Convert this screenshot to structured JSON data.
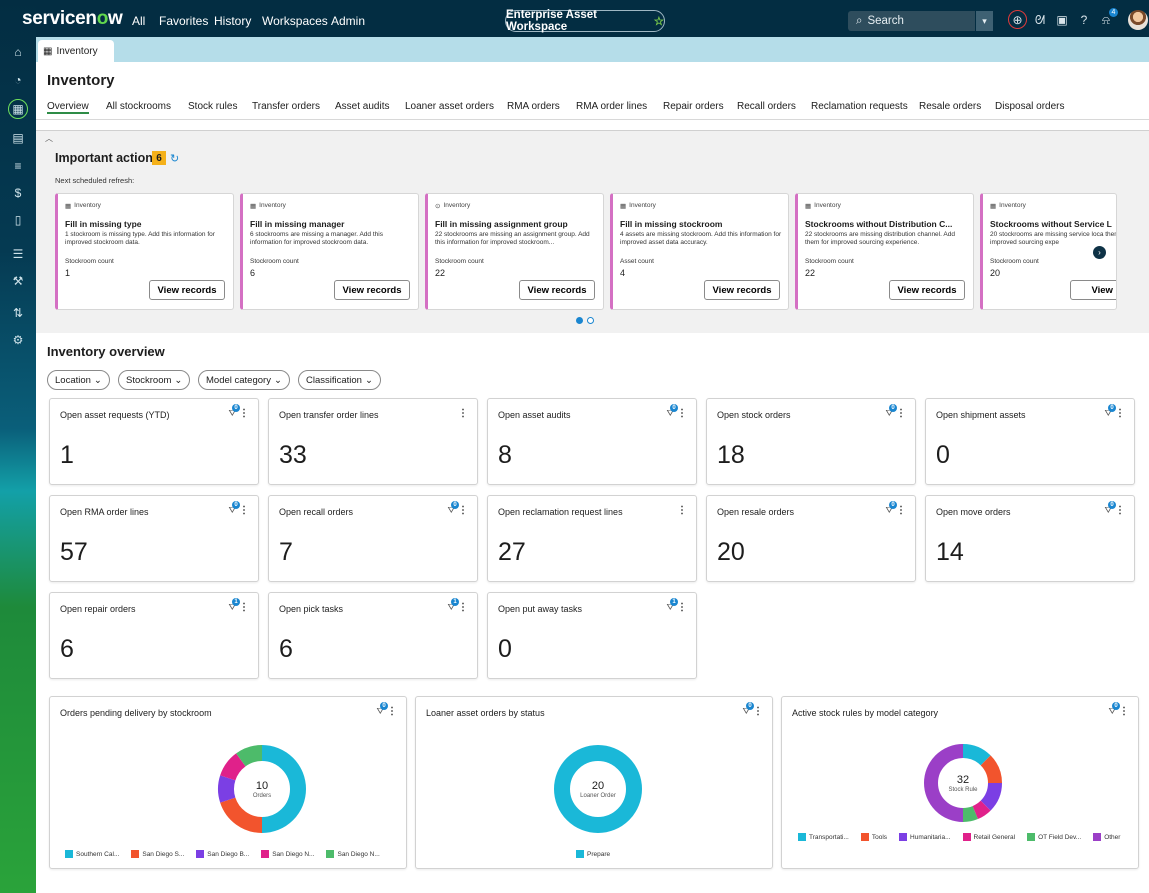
{
  "topbar": {
    "brand_prefix": "servicen",
    "brand_o": "o",
    "brand_suffix": "w",
    "nav": [
      "All",
      "Favorites",
      "History",
      "Workspaces",
      "Admin"
    ],
    "workspace": "Enterprise Asset Workspace",
    "search_placeholder": "Search",
    "notification_count": "4"
  },
  "tab": {
    "label": "Inventory"
  },
  "page": {
    "title": "Inventory"
  },
  "subtabs": [
    "Overview",
    "All stockrooms",
    "Stock rules",
    "Transfer orders",
    "Asset audits",
    "Loaner asset orders",
    "RMA orders",
    "RMA order lines",
    "Repair orders",
    "Recall orders",
    "Reclamation requests",
    "Resale orders",
    "Disposal orders"
  ],
  "important_actions": {
    "title": "Important actions",
    "count": "6",
    "next_refresh": "Next scheduled refresh:",
    "cards": [
      {
        "kicker": "Inventory",
        "title": "Fill in missing type",
        "desc": "1 stockroom is missing type. Add this information for improved stockroom data.",
        "label": "Stockroom count",
        "value": "1",
        "button": "View records"
      },
      {
        "kicker": "Inventory",
        "title": "Fill in missing manager",
        "desc": "6 stockrooms are missing a manager. Add this information for improved stockroom data.",
        "label": "Stockroom count",
        "value": "6",
        "button": "View records"
      },
      {
        "kicker": "Inventory",
        "title": "Fill in missing assignment group",
        "desc": "22 stockrooms are missing an assignment group. Add this information for improved stockroom...",
        "label": "Stockroom count",
        "value": "22",
        "button": "View records"
      },
      {
        "kicker": "Inventory",
        "title": "Fill in missing stockroom",
        "desc": "4 assets are missing stockroom. Add this information for improved asset data accuracy.",
        "label": "Asset count",
        "value": "4",
        "button": "View records"
      },
      {
        "kicker": "Inventory",
        "title": "Stockrooms without Distribution C...",
        "desc": "22 stockrooms are missing distribution channel. Add them for improved sourcing experience.",
        "label": "Stockroom count",
        "value": "22",
        "button": "View records"
      },
      {
        "kicker": "Inventory",
        "title": "Stockrooms without Service L",
        "desc": "20 stockrooms are missing service loca them for improved sourcing expe",
        "label": "Stockroom count",
        "value": "20",
        "button": "View re"
      }
    ]
  },
  "overview": {
    "title": "Inventory overview",
    "filters": [
      "Location",
      "Stockroom",
      "Model category",
      "Classification"
    ],
    "kpis": [
      {
        "label": "Open asset requests (YTD)",
        "value": "1",
        "filter_badge": "0",
        "has_filter": true
      },
      {
        "label": "Open transfer order lines",
        "value": "33",
        "filter_badge": "",
        "has_filter": false
      },
      {
        "label": "Open asset audits",
        "value": "8",
        "filter_badge": "0",
        "has_filter": true
      },
      {
        "label": "Open stock orders",
        "value": "18",
        "filter_badge": "0",
        "has_filter": true
      },
      {
        "label": "Open shipment assets",
        "value": "0",
        "filter_badge": "0",
        "has_filter": true
      },
      {
        "label": "Open RMA order lines",
        "value": "57",
        "filter_badge": "0",
        "has_filter": true
      },
      {
        "label": "Open recall orders",
        "value": "7",
        "filter_badge": "0",
        "has_filter": true
      },
      {
        "label": "Open reclamation request lines",
        "value": "27",
        "filter_badge": "",
        "has_filter": false
      },
      {
        "label": "Open resale orders",
        "value": "20",
        "filter_badge": "0",
        "has_filter": true
      },
      {
        "label": "Open move orders",
        "value": "14",
        "filter_badge": "0",
        "has_filter": true
      },
      {
        "label": "Open repair orders",
        "value": "6",
        "filter_badge": "1",
        "has_filter": true
      },
      {
        "label": "Open pick tasks",
        "value": "6",
        "filter_badge": "1",
        "has_filter": true
      },
      {
        "label": "Open put away tasks",
        "value": "0",
        "filter_badge": "1",
        "has_filter": true
      }
    ]
  },
  "chart_data": [
    {
      "type": "pie",
      "title": "Orders pending delivery by stockroom",
      "center_value": "10",
      "center_label": "Orders",
      "filter_badge": "0",
      "categories": [
        "Southern Cal...",
        "San Diego S...",
        "San Diego B...",
        "San Diego N...",
        "San Diego N..."
      ],
      "values": [
        5,
        2,
        1,
        1,
        1
      ],
      "colors": [
        "#1ab8d8",
        "#f2542d",
        "#7b3fe4",
        "#e0218a",
        "#4dbb6a"
      ]
    },
    {
      "type": "pie",
      "title": "Loaner asset orders by status",
      "center_value": "20",
      "center_label": "Loaner Order",
      "filter_badge": "0",
      "categories": [
        "Prepare"
      ],
      "values": [
        20
      ],
      "colors": [
        "#1ab8d8"
      ]
    },
    {
      "type": "pie",
      "title": "Active stock rules by model category",
      "center_value": "32",
      "center_label": "Stock Rule",
      "filter_badge": "0",
      "categories": [
        "Transportati...",
        "Tools",
        "Humanitaria...",
        "Retail General",
        "OT Field Dev...",
        "Other"
      ],
      "values": [
        4,
        4,
        4,
        2,
        2,
        16
      ],
      "colors": [
        "#1ab8d8",
        "#f2542d",
        "#7b3fe4",
        "#e0218a",
        "#4dbb6a",
        "#9b3fc7"
      ]
    }
  ]
}
